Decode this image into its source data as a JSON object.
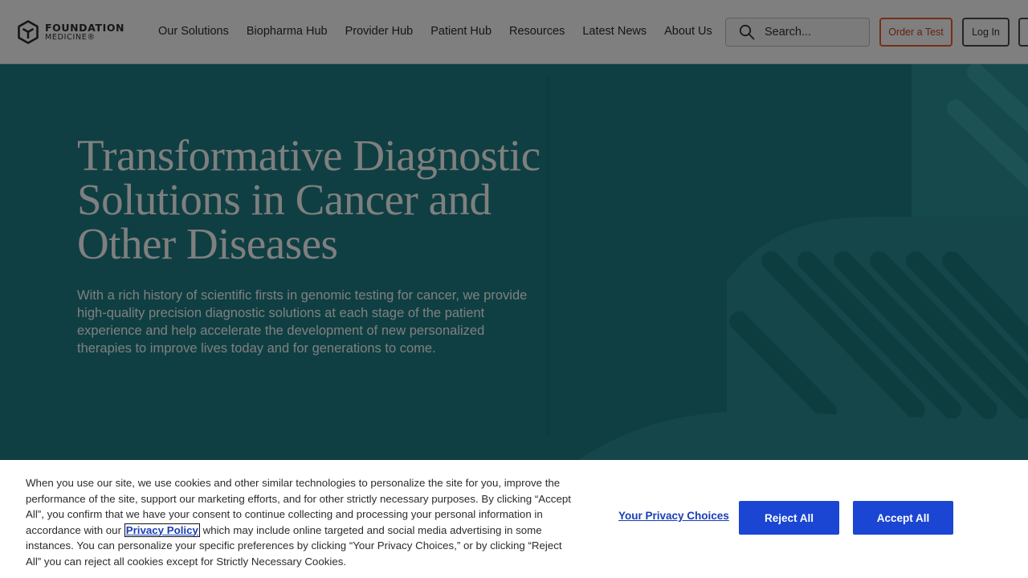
{
  "header": {
    "logo": {
      "line1": "FOUNDATION",
      "line2": "MEDICINE®"
    },
    "nav": [
      "Our Solutions",
      "Biopharma Hub",
      "Provider Hub",
      "Patient Hub",
      "Resources",
      "Latest News",
      "About Us"
    ],
    "search": {
      "placeholder": "Search..."
    },
    "order_label": "Order a Test",
    "login_label": "Log In"
  },
  "hero": {
    "title": "Transformative Diagnostic Solutions in Cancer and Other Diseases",
    "description": "With a rich history of scientific firsts in genomic testing for cancer, we provide high-quality precision diagnostic solutions at each stage of the patient experience and help accelerate the development of new personalized therapies to improve lives today and for generations to come."
  },
  "cookie_banner": {
    "text_before": "When you use our site, we use cookies and other similar technologies to personalize the site for you, improve the performance of the site, support our marketing efforts, and for other strictly necessary purposes. By clicking “Accept All”, you confirm that we have your consent to continue collecting and processing your personal information in accordance with our ",
    "privacy_link": "Privacy Policy",
    "text_after": " which may include online targeted and social media advertising in some instances. You can personalize your specific preferences by clicking “Your Privacy Choices,” or by clicking “Reject All” you can reject all cookies except for Strictly Necessary Cookies.",
    "choices_label": "Your Privacy Choices",
    "reject_label": "Reject All",
    "accept_label": "Accept All"
  },
  "colors": {
    "hero_bg": "#1e7f85",
    "accent_orange": "#e8602c",
    "primary_blue": "#1a46d3"
  },
  "icons": {
    "logo": "hexagon-cube-logo-icon",
    "search": "search-icon"
  }
}
